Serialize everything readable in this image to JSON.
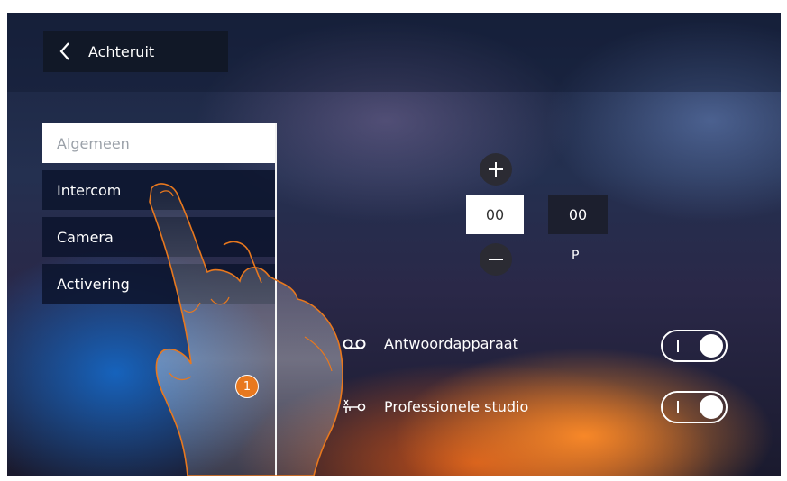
{
  "header": {
    "back_label": "Achteruit"
  },
  "menu": {
    "items": [
      {
        "label": "Algemeen",
        "active": true
      },
      {
        "label": "Intercom",
        "active": false
      },
      {
        "label": "Camera",
        "active": false
      },
      {
        "label": "Activering",
        "active": false
      }
    ]
  },
  "address": {
    "selected_value": "00",
    "secondary_value": "00",
    "secondary_label": "P"
  },
  "settings": [
    {
      "label": "Antwoordapparaat",
      "icon": "voicemail-icon",
      "enabled": true
    },
    {
      "label": "Professionele studio",
      "icon": "key-icon",
      "enabled": true
    }
  ],
  "annotation": {
    "step": "1"
  },
  "colors": {
    "accent_orange": "#e8781e",
    "panel_dark": "#111827",
    "active_item": "#ffffff"
  }
}
